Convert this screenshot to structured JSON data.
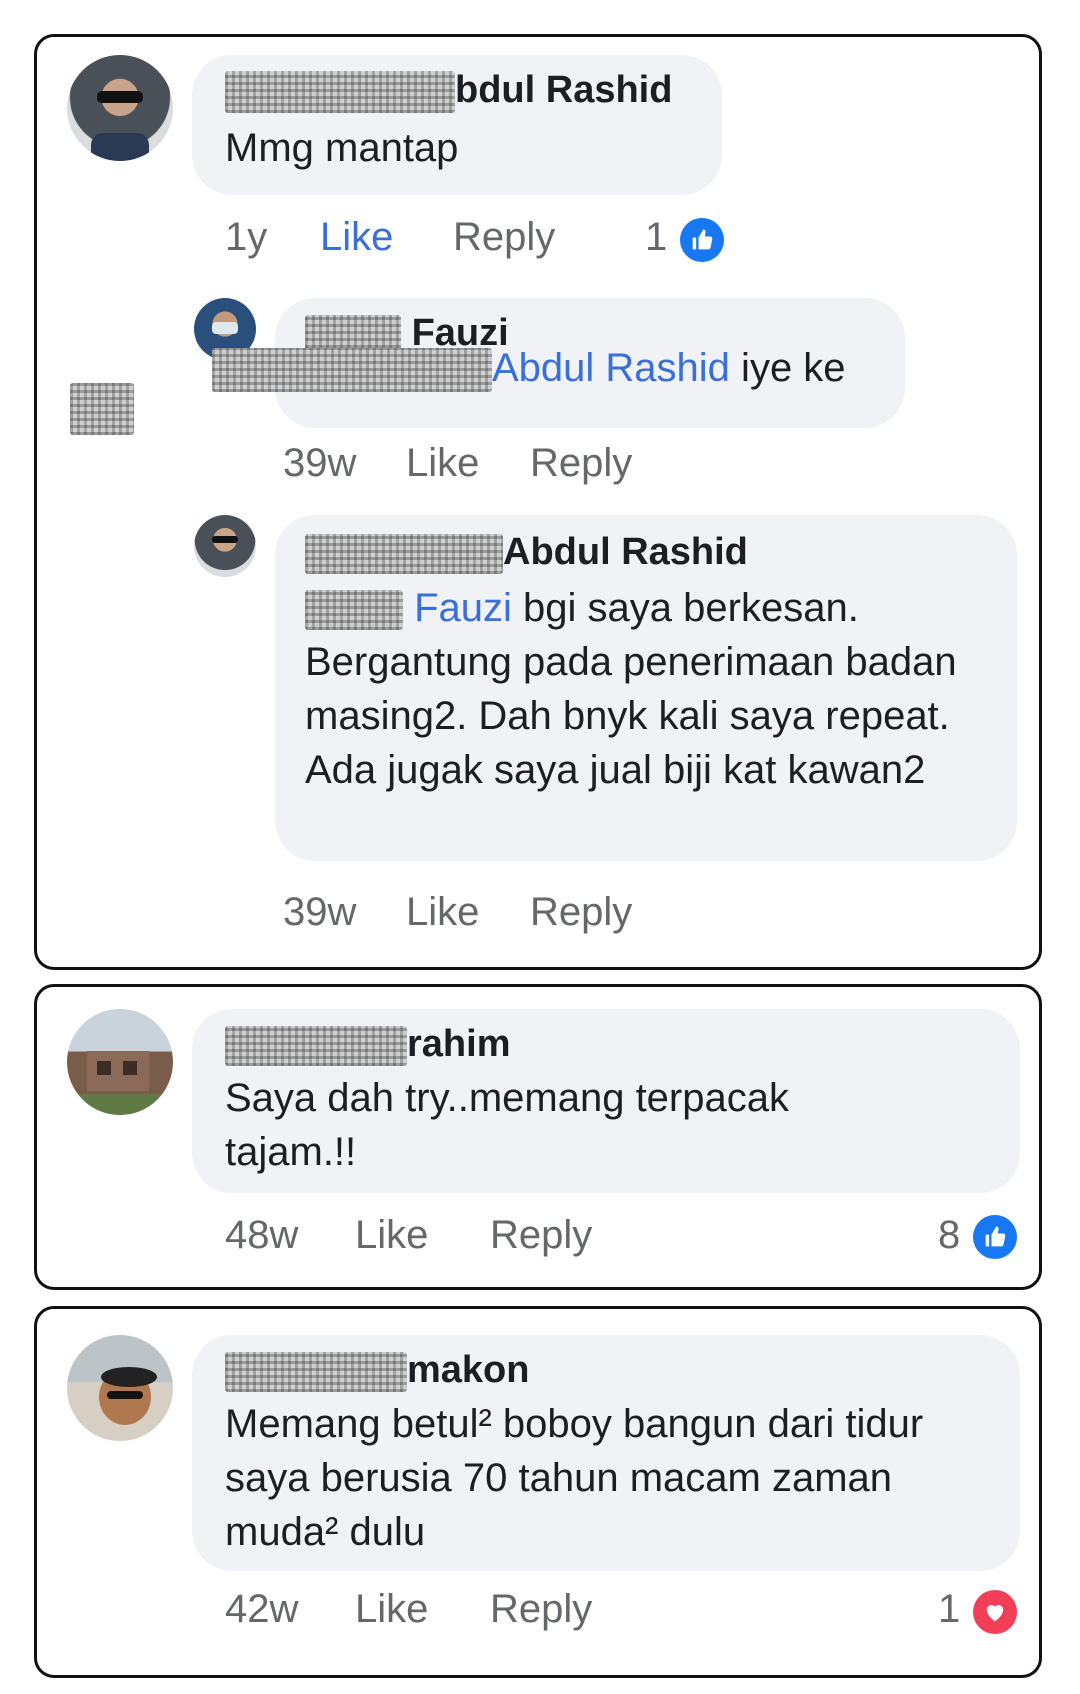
{
  "comment1": {
    "name_visible": "bdul Rashid",
    "text": "Mmg mantap",
    "time": "1y",
    "like": "Like",
    "reply": "Reply",
    "reaction_count": "1",
    "reaction_icon": "like-thumb-icon",
    "reaction_color": "#1877f2",
    "replies": [
      {
        "name_visible": "Fauzi",
        "mention": "Abdul Rashid",
        "text": " iye ke",
        "time": "39w",
        "like": "Like",
        "reply": "Reply"
      },
      {
        "name_visible": "Abdul Rashid",
        "mention": "Fauzi",
        "text_first": " bgi saya berkesan.",
        "text_rest": "Bergantung pada penerimaan badan masing2. Dah bnyk kali saya repeat. Ada jugak saya jual biji kat kawan2",
        "time": "39w",
        "like": "Like",
        "reply": "Reply"
      }
    ]
  },
  "comment2": {
    "name_visible": "rahim",
    "text": "Saya dah try..memang terpacak tajam.!!",
    "time": "48w",
    "like": "Like",
    "reply": "Reply",
    "reaction_count": "8",
    "reaction_icon": "like-thumb-icon",
    "reaction_color": "#1877f2"
  },
  "comment3": {
    "name_visible": "makon",
    "text": "Memang betul² boboy bangun dari tidur saya berusia 70 tahun macam zaman muda² dulu",
    "time": "42w",
    "like": "Like",
    "reply": "Reply",
    "reaction_count": "1",
    "reaction_icon": "love-heart-icon",
    "reaction_color": "#f33e58"
  }
}
